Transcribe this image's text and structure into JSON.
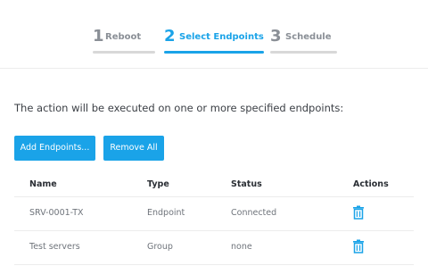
{
  "wizard": {
    "steps": [
      {
        "number": "1",
        "label": "Reboot",
        "state": "inactive"
      },
      {
        "number": "2",
        "label": "Select Endpoints",
        "state": "active"
      },
      {
        "number": "3",
        "label": "Schedule",
        "state": "inactive"
      }
    ]
  },
  "main": {
    "intro": "The action will be executed on one or more specified endpoints:",
    "add_button": "Add Endpoints...",
    "remove_button": "Remove All"
  },
  "table": {
    "headers": {
      "name": "Name",
      "type": "Type",
      "status": "Status",
      "actions": "Actions"
    },
    "rows": [
      {
        "name": "SRV-0001-TX",
        "type": "Endpoint",
        "status": "Connected",
        "action_icon": "trash-icon"
      },
      {
        "name": "Test servers",
        "type": "Group",
        "status": "none",
        "action_icon": "trash-icon"
      }
    ]
  },
  "colors": {
    "accent": "#1aa3e8",
    "inactive_text": "#8a8f96",
    "inactive_bar": "#d8d8d8"
  }
}
